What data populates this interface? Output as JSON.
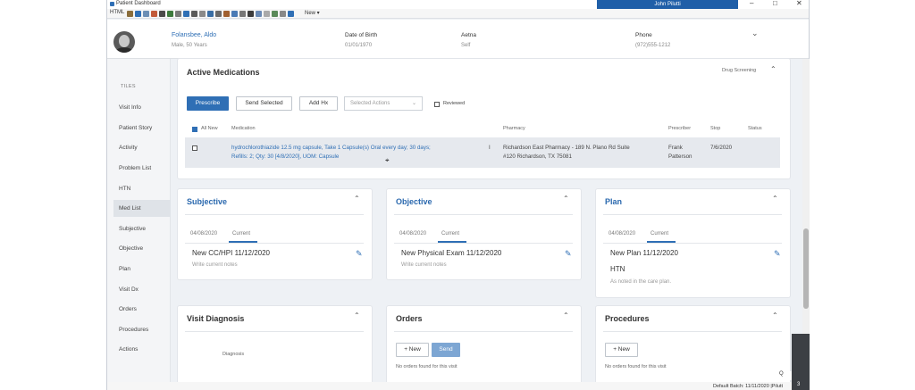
{
  "window": {
    "title": "Patient Dashboard",
    "user": "John Pilutti",
    "controls": [
      "–",
      "□",
      "✕"
    ]
  },
  "toolbar": {
    "new_label": "New ▾",
    "html_label": "HTML"
  },
  "patient": {
    "name": "Folansbee, Aldo",
    "sub": "Male, 50 Years",
    "dob_label": "Date of Birth",
    "dob": "01/01/1970",
    "insurance_label": "Aetna",
    "insurance_val": "Self",
    "phone_label": "Phone",
    "phone": "(972)555-1212"
  },
  "sidebar": {
    "header": "TILES",
    "items": [
      "Visit Info",
      "Patient Story",
      "Activity",
      "Problem List",
      "HTN",
      "Med List",
      "Subjective",
      "Objective",
      "Plan",
      "Visit Dx",
      "Orders",
      "Procedures",
      "Actions"
    ],
    "active": "Med List"
  },
  "medications": {
    "title": "Active Medications",
    "drug_screening": "Drug Screening",
    "prescribe": "Prescribe",
    "send_selected": "Send Selected",
    "add_hx": "Add Hx",
    "selected_actions": "Selected Actions",
    "reviewed": "Reviewed",
    "columns": [
      "All New",
      "Medication",
      "Pharmacy",
      "Prescriber",
      "Stop",
      "Status"
    ],
    "row": {
      "med_line1": "hydrochlorothiazide 12.5 mg capsule, Take 1 Capsule(s) Oral every day; 30 days;",
      "med_line2": "Refills: 2; Qty: 30 [4/8/2020], UOM: Capsule",
      "qty_flag": "I",
      "pharmacy_line1": "Richardson East Pharmacy - 189 N. Plano Rd Suite",
      "pharmacy_line2": "#120 Richardson, TX 75081",
      "prescriber_line1": "Frank",
      "prescriber_line2": "Patterson",
      "stop": "7/6/2020"
    }
  },
  "subjective": {
    "title": "Subjective",
    "tab_date": "04/08/2020",
    "tab_current": "Current",
    "note_title": "New CC/HPI 11/12/2020",
    "note_sub": "Write current notes"
  },
  "objective": {
    "title": "Objective",
    "tab_date": "04/08/2020",
    "tab_current": "Current",
    "note_title": "New Physical Exam 11/12/2020",
    "note_sub": "Write current notes"
  },
  "plan": {
    "title": "Plan",
    "tab_date": "04/08/2020",
    "tab_current": "Current",
    "note_title": "New Plan 11/12/2020",
    "note_extra": "HTN",
    "note_sub": "As noted in the care plan."
  },
  "visit_diagnosis": {
    "title": "Visit Diagnosis",
    "col": "Diagnosis"
  },
  "orders": {
    "title": "Orders",
    "new": "+ New",
    "send": "Send",
    "empty": "No orders found for this visit"
  },
  "procedures": {
    "title": "Procedures",
    "new": "+ New",
    "empty": "No orders found for this visit"
  },
  "status": {
    "batch": "Default Batch: 11/11/2020 |Pilutt",
    "right": "3",
    "q": "Q"
  }
}
